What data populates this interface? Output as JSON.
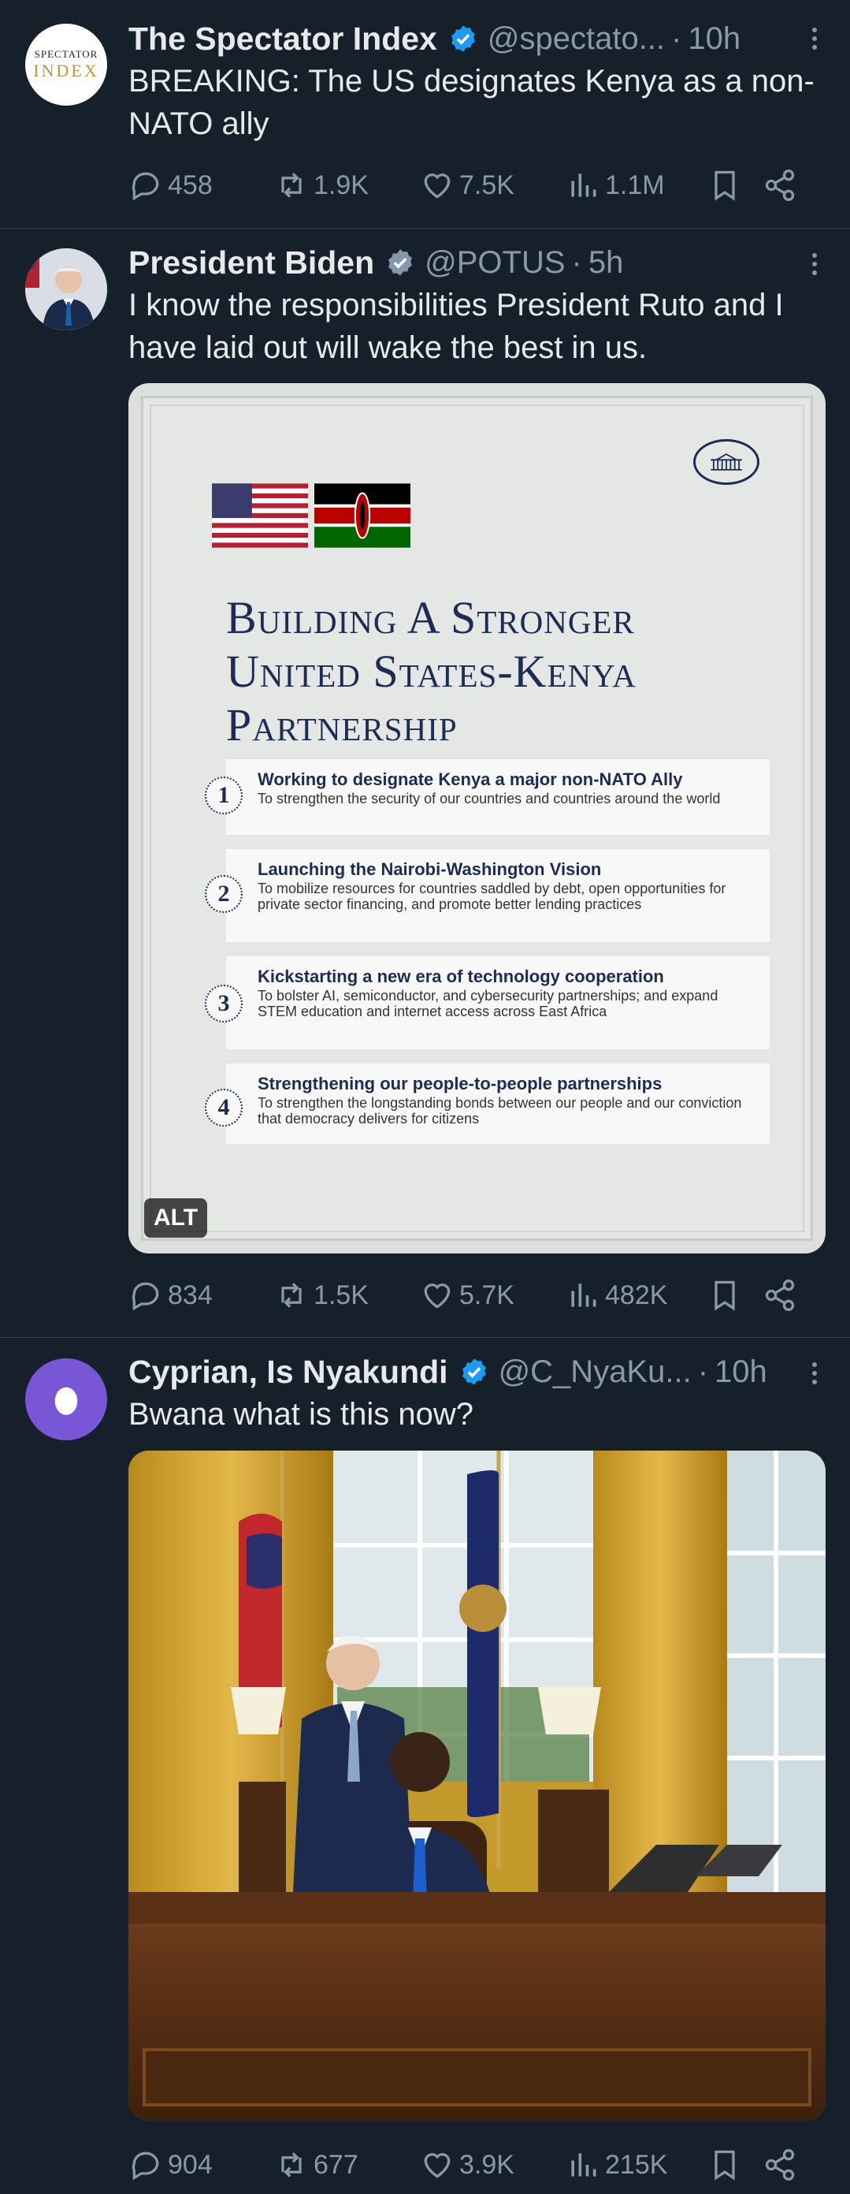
{
  "tweets": [
    {
      "author": "The Spectator Index",
      "handle": "@spectato...",
      "time": "10h",
      "text": "BREAKING: The US designates Kenya as a non-NATO ally",
      "stats": {
        "replies": "458",
        "reposts": "1.9K",
        "likes": "7.5K",
        "views": "1.1M"
      },
      "avatar_lines": [
        "SPECTATOR",
        "INDEX"
      ]
    },
    {
      "author": "President Biden",
      "handle": "@POTUS",
      "time": "5h",
      "text": "I know the responsibilities President Ruto and I have laid out will wake the best in us.",
      "stats": {
        "replies": "834",
        "reposts": "1.5K",
        "likes": "5.7K",
        "views": "482K"
      },
      "poster": {
        "title_lines": [
          "Building A Stronger",
          "United States-Kenya",
          "Partnership"
        ],
        "items": [
          {
            "num": "1",
            "title": "Working to designate Kenya a major non-NATO Ally",
            "desc": "To strengthen the security of our countries and countries around the world"
          },
          {
            "num": "2",
            "title": "Launching the Nairobi-Washington Vision",
            "desc": "To mobilize resources for countries saddled by debt, open opportunities for private sector financing, and promote better lending practices"
          },
          {
            "num": "3",
            "title": "Kickstarting a new era of technology cooperation",
            "desc": "To bolster AI, semiconductor, and cybersecurity partnerships; and expand STEM education and internet access across East Africa"
          },
          {
            "num": "4",
            "title": "Strengthening our people-to-people partnerships",
            "desc": "To strengthen the longstanding bonds between our people and our conviction that democracy delivers for citizens"
          }
        ],
        "alt_badge": "ALT"
      }
    },
    {
      "author": "Cyprian, Is Nyakundi",
      "handle": "@C_NyaKu...",
      "time": "10h",
      "text": "Bwana what is this now?",
      "stats": {
        "replies": "904",
        "reposts": "677",
        "likes": "3.9K",
        "views": "215K"
      }
    }
  ],
  "colors": {
    "background": "#15202b",
    "verified": "#1d9bf0",
    "verified_gray": "#829aab",
    "secondary_text": "#8b98a5",
    "purple_avatar": "#7856d6"
  }
}
